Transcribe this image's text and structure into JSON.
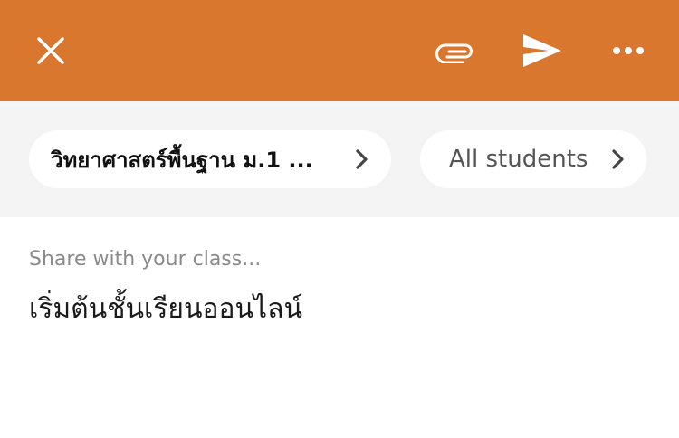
{
  "header": {
    "background": "#d9772f",
    "icons": {
      "close": "close-icon",
      "attach": "paperclip-icon",
      "send": "send-icon",
      "more": "more-horizontal-icon"
    }
  },
  "selectors": {
    "class_label": "วิทยาศาสตร์พื้นฐาน ม.1 ...",
    "audience_label": "All students"
  },
  "composer": {
    "placeholder": "Share with your class...",
    "text": "เริ่มต้นชั้นเรียนออนไลน์"
  }
}
